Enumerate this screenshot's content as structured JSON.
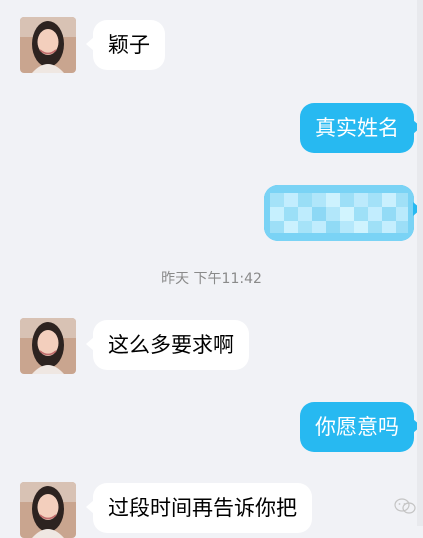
{
  "chat": {
    "timestamp": "昨天 下午11:42",
    "messages": [
      {
        "from": "contact",
        "text": "颖子"
      },
      {
        "from": "me",
        "text": "真实姓名"
      },
      {
        "from": "me",
        "text": "",
        "redacted": true
      },
      {
        "from": "contact",
        "text": "这么多要求啊"
      },
      {
        "from": "me",
        "text": "你愿意吗"
      },
      {
        "from": "contact",
        "text": "过段时间再告诉你把"
      }
    ]
  },
  "watermark": {
    "icon": "wechat-icon",
    "text": "·"
  },
  "colors": {
    "background": "#f1f2f6",
    "incoming_bubble": "#ffffff",
    "outgoing_bubble": "#27b9f1",
    "timestamp_text": "#8a8a8a"
  }
}
